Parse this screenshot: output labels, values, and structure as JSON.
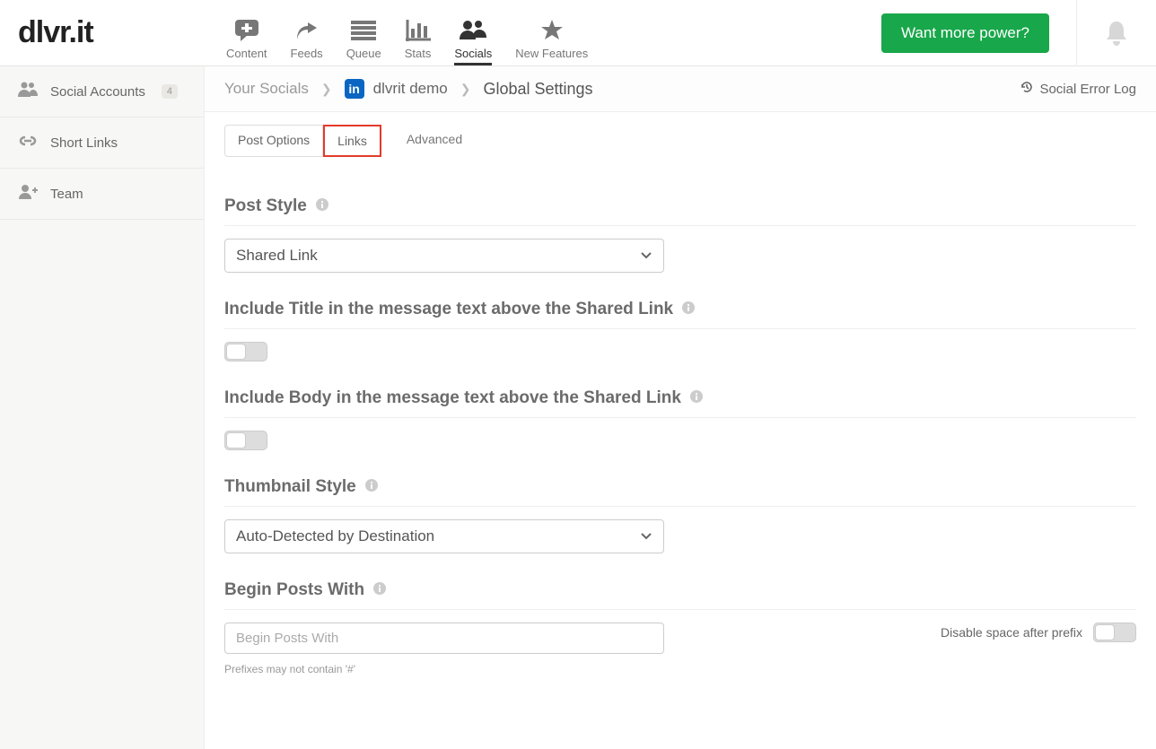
{
  "logo": "dlvr.it",
  "topnav": {
    "content": "Content",
    "feeds": "Feeds",
    "queue": "Queue",
    "stats": "Stats",
    "socials": "Socials",
    "new_features": "New Features"
  },
  "cta": "Want more power?",
  "sidebar": {
    "social_accounts": {
      "label": "Social Accounts",
      "badge": "4"
    },
    "short_links": {
      "label": "Short Links"
    },
    "team": {
      "label": "Team"
    }
  },
  "crumbs": {
    "root": "Your Socials",
    "account": "dlvrit demo",
    "current": "Global Settings",
    "error_log": "Social Error Log"
  },
  "tabs": {
    "post_options": "Post Options",
    "links": "Links",
    "advanced": "Advanced"
  },
  "sections": {
    "post_style": {
      "title": "Post Style",
      "value": "Shared Link"
    },
    "include_title": {
      "title": "Include Title in the message text above the Shared Link"
    },
    "include_body": {
      "title": "Include Body in the message text above the Shared Link"
    },
    "thumbnail_style": {
      "title": "Thumbnail Style",
      "value": "Auto-Detected by Destination"
    },
    "begin_with": {
      "title": "Begin Posts With",
      "placeholder": "Begin Posts With",
      "helper": "Prefixes may not contain '#'",
      "disable_space": "Disable space after prefix"
    }
  }
}
